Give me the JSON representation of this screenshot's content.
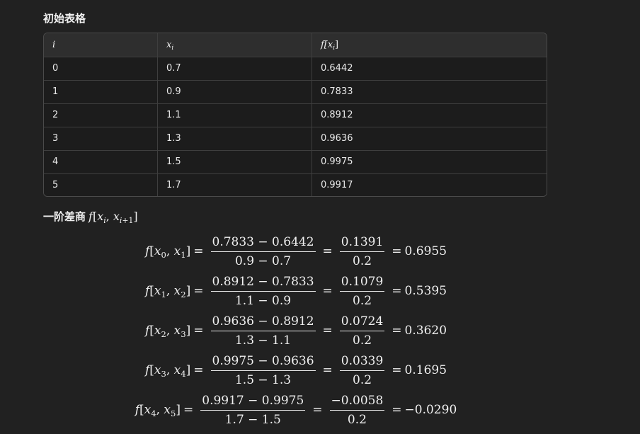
{
  "sections": {
    "initial_table_title": "初始表格",
    "first_diff_title": "一阶差商"
  },
  "table": {
    "headers": [
      "i",
      "x",
      "f[x",
      "]"
    ],
    "rows": [
      [
        "0",
        "0.7",
        "0.6442"
      ],
      [
        "1",
        "0.9",
        "0.7833"
      ],
      [
        "2",
        "1.1",
        "0.8912"
      ],
      [
        "3",
        "1.3",
        "0.9636"
      ],
      [
        "4",
        "1.5",
        "0.9975"
      ],
      [
        "5",
        "1.7",
        "0.9917"
      ]
    ]
  },
  "equations": [
    {
      "lhs_a": "0",
      "lhs_b": "1",
      "num": "0.7833 − 0.6442",
      "den": "0.9 − 0.7",
      "num2": "0.1391",
      "den2": "0.2",
      "result": "0.6955"
    },
    {
      "lhs_a": "1",
      "lhs_b": "2",
      "num": "0.8912 − 0.7833",
      "den": "1.1 − 0.9",
      "num2": "0.1079",
      "den2": "0.2",
      "result": "0.5395"
    },
    {
      "lhs_a": "2",
      "lhs_b": "3",
      "num": "0.9636 − 0.8912",
      "den": "1.3 − 1.1",
      "num2": "0.0724",
      "den2": "0.2",
      "result": "0.3620"
    },
    {
      "lhs_a": "3",
      "lhs_b": "4",
      "num": "0.9975 − 0.9636",
      "den": "1.5 − 1.3",
      "num2": "0.0339",
      "den2": "0.2",
      "result": "0.1695"
    },
    {
      "lhs_a": "4",
      "lhs_b": "5",
      "num": "0.9917 − 0.9975",
      "den": "1.7 − 1.5",
      "num2": "−0.0058",
      "den2": "0.2",
      "result": "−0.0290"
    }
  ]
}
